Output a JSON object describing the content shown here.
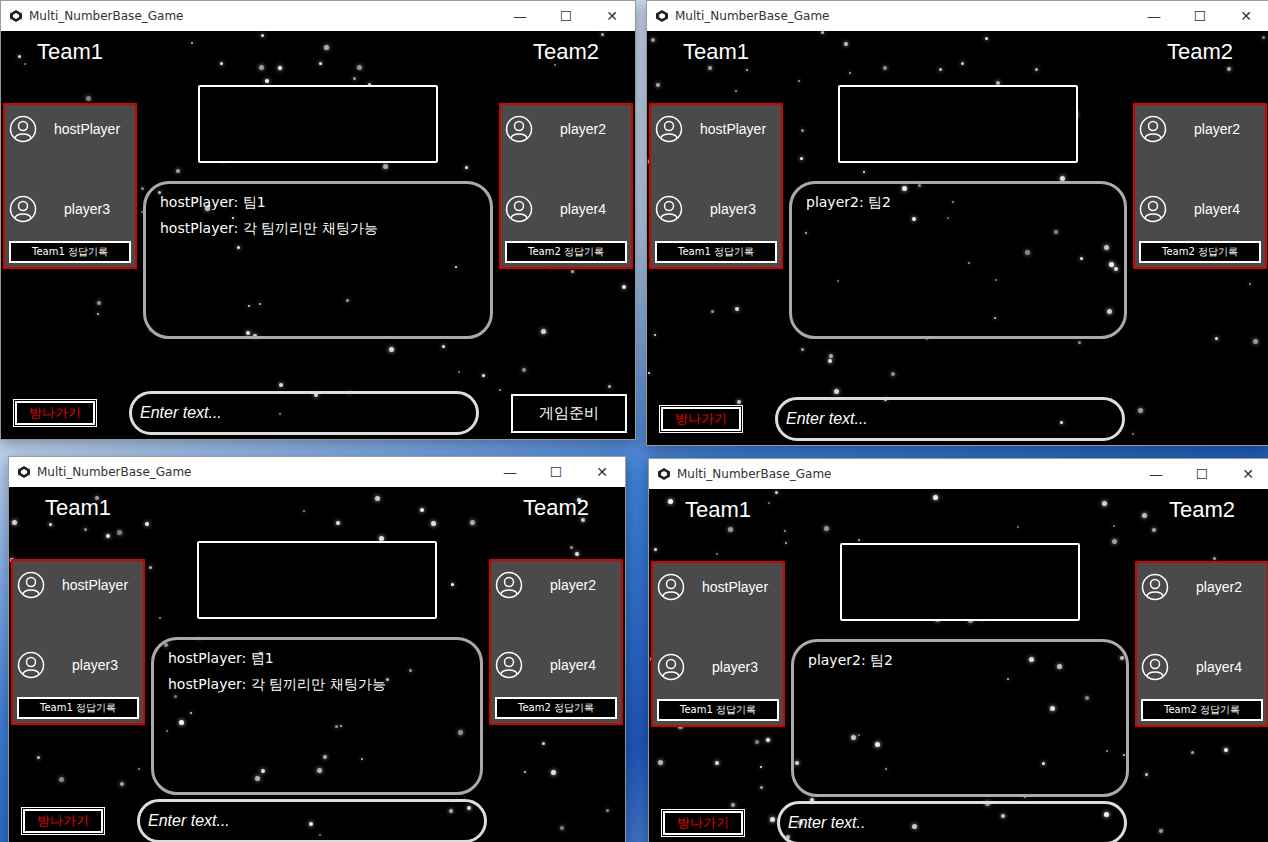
{
  "windows": [
    {
      "title": "Multi_NumberBase_Game",
      "controls": [
        "—",
        "☐",
        "✕"
      ],
      "team1": {
        "label": "Team1",
        "players": [
          {
            "name": "hostPlayer"
          },
          {
            "name": "player3"
          }
        ],
        "record_button": "Team1 정답기록"
      },
      "team2": {
        "label": "Team2",
        "players": [
          {
            "name": "player2"
          },
          {
            "name": "player4"
          }
        ],
        "record_button": "Team2 정답기록"
      },
      "chat": [
        "hostPlayer: 팀1",
        "hostPlayer: 각 팀끼리만 채팅가능"
      ],
      "leave_button": "방나가기",
      "input_placeholder": "Enter text...",
      "ready_button": "게임준비"
    },
    {
      "title": "Multi_NumberBase_Game",
      "controls": [
        "—",
        "☐",
        "✕"
      ],
      "team1": {
        "label": "Team1",
        "players": [
          {
            "name": "hostPlayer"
          },
          {
            "name": "player3"
          }
        ],
        "record_button": "Team1 정답기록"
      },
      "team2": {
        "label": "Team2",
        "players": [
          {
            "name": "player2"
          },
          {
            "name": "player4"
          }
        ],
        "record_button": "Team2 정답기록"
      },
      "chat": [
        "player2: 팀2"
      ],
      "leave_button": "방나가기",
      "input_placeholder": "Enter text..."
    },
    {
      "title": "Multi_NumberBase_Game",
      "controls": [
        "—",
        "☐",
        "✕"
      ],
      "team1": {
        "label": "Team1",
        "players": [
          {
            "name": "hostPlayer"
          },
          {
            "name": "player3"
          }
        ],
        "record_button": "Team1 정답기록"
      },
      "team2": {
        "label": "Team2",
        "players": [
          {
            "name": "player2"
          },
          {
            "name": "player4"
          }
        ],
        "record_button": "Team2 정답기록"
      },
      "chat": [
        "hostPlayer: 팀1",
        "hostPlayer: 각 팀끼리만 채팅가능"
      ],
      "leave_button": "방나가기",
      "input_placeholder": "Enter text..."
    },
    {
      "title": "Multi_NumberBase_Game",
      "controls": [
        "—",
        "☐",
        "✕"
      ],
      "team1": {
        "label": "Team1",
        "players": [
          {
            "name": "hostPlayer"
          },
          {
            "name": "player3"
          }
        ],
        "record_button": "Team1 정답기록"
      },
      "team2": {
        "label": "Team2",
        "players": [
          {
            "name": "player2"
          },
          {
            "name": "player4"
          }
        ],
        "record_button": "Team2 정답기록"
      },
      "chat": [
        "player2: 팀2"
      ],
      "leave_button": "방나가기",
      "input_placeholder": "Enter text.."
    }
  ]
}
